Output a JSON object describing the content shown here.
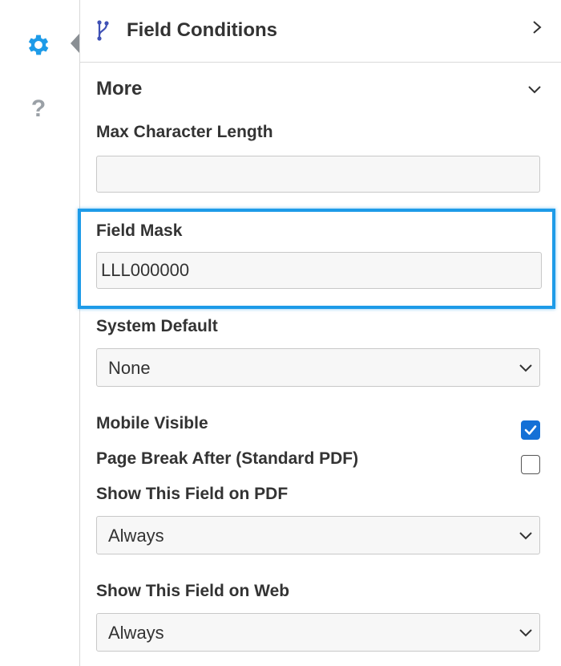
{
  "left_rail": {
    "icons": [
      "gear-icon",
      "help-icon"
    ],
    "help_glyph": "?",
    "accent_color": "#1e9be8"
  },
  "field_conditions": {
    "title": "Field Conditions",
    "icon": "branch-icon",
    "expand_icon": "chevron-right-icon"
  },
  "more": {
    "title": "More",
    "collapse_icon": "chevron-down-icon"
  },
  "max_character_length": {
    "label": "Max Character Length",
    "value": ""
  },
  "field_mask": {
    "label": "Field Mask",
    "value": "LLL000000",
    "highlight_color": "#1e9be8"
  },
  "system_default": {
    "label": "System Default",
    "selected": "None"
  },
  "mobile_visible": {
    "label": "Mobile Visible",
    "checked": true,
    "check_color": "#1470d6"
  },
  "page_break_after": {
    "label": "Page Break After (Standard PDF)",
    "checked": false
  },
  "show_on_pdf": {
    "label": "Show This Field on PDF",
    "selected": "Always"
  },
  "show_on_web": {
    "label": "Show This Field on Web",
    "selected": "Always"
  }
}
